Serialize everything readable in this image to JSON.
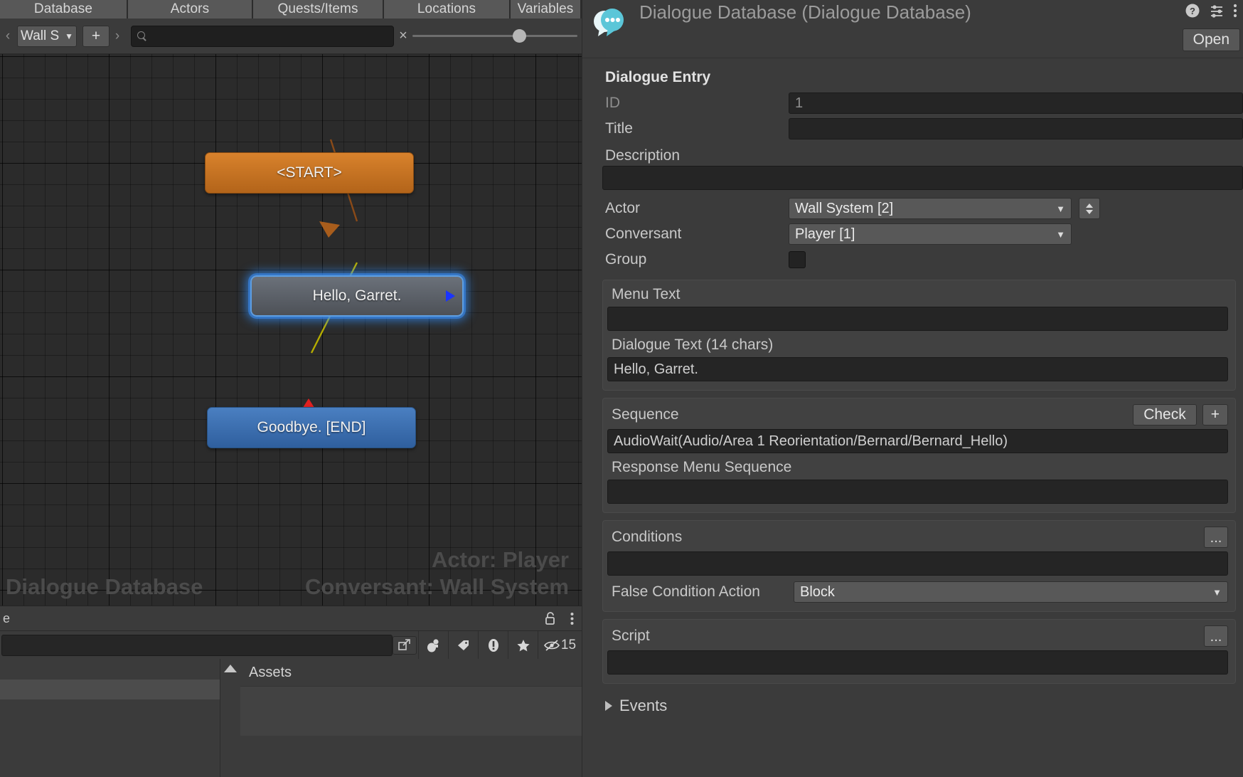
{
  "editor": {
    "tabs": [
      {
        "label": "Database",
        "name": "tab-database"
      },
      {
        "label": "Actors",
        "name": "tab-actors"
      },
      {
        "label": "Quests/Items",
        "name": "tab-quests-items"
      },
      {
        "label": "Locations",
        "name": "tab-locations"
      },
      {
        "label": "Variables",
        "name": "tab-variables"
      }
    ],
    "toolbar": {
      "prev_arrow": "‹",
      "next_arrow": "›",
      "conversation_picker": "Wall S",
      "picker_caret": "▼",
      "add_label": "+",
      "search_value": "",
      "search_placeholder": "",
      "clear_label": "×"
    },
    "graph": {
      "nodes": [
        {
          "label": "<START>",
          "name": "node-start"
        },
        {
          "label": "Hello, Garret.",
          "name": "node-hello-garret"
        },
        {
          "label": "Goodbye. [END]",
          "name": "node-goodbye-end"
        }
      ],
      "watermarks": {
        "database": "Dialogue Database",
        "actor": "Actor: Player",
        "conversant": "Conversant: Wall System"
      },
      "link_colors": {
        "start_link": "#8a4a18",
        "selected_link": "#b5ad00",
        "port_blue": "#1a34ff",
        "incoming_red": "#e02020"
      }
    },
    "left_strip": {
      "fragment_text": "e",
      "lock_icon": "lock-open-icon",
      "menu_icon": "kebab-menu-icon"
    },
    "status_bar": {
      "message": "",
      "popout_icon": "popout-icon",
      "icons": [
        {
          "name": "account-icon",
          "glyph": ""
        },
        {
          "name": "tag-icon",
          "glyph": ""
        },
        {
          "name": "warning-icon",
          "glyph": ""
        },
        {
          "name": "favorite-star-icon",
          "glyph": ""
        }
      ],
      "hidden_count": "15",
      "hidden_icon": "eye-off-icon"
    },
    "project": {
      "assets_label": "Assets",
      "collapse_icon": "triangle-up-icon"
    }
  },
  "inspector": {
    "icon_name": "dialogue-database-icon",
    "title": "Dialogue Database (Dialogue Database)",
    "help_icon": "help-icon",
    "preset_icon": "preset-sliders-icon",
    "menu_icon": "kebab-menu-icon",
    "open_label": "Open",
    "section_title": "Dialogue Entry",
    "fields": {
      "id_label": "ID",
      "id_value": "1",
      "title_label": "Title",
      "title_value": "",
      "description_label": "Description",
      "description_value": "",
      "actor_label": "Actor",
      "actor_value": "Wall System [2]",
      "conversant_label": "Conversant",
      "conversant_value": "Player [1]",
      "group_label": "Group",
      "group_checked": false
    },
    "text_group": {
      "menu_text_label": "Menu Text",
      "menu_text_value": "",
      "dialogue_text_label": "Dialogue Text (14 chars)",
      "dialogue_text_value": "Hello, Garret."
    },
    "sequence_group": {
      "sequence_label": "Sequence",
      "check_label": "Check",
      "add_label": "+",
      "sequence_value": "AudioWait(Audio/Area 1 Reorientation/Bernard/Bernard_Hello)",
      "response_menu_label": "Response Menu Sequence",
      "response_menu_value": ""
    },
    "conditions_group": {
      "conditions_label": "Conditions",
      "dots_label": "...",
      "conditions_value": "",
      "false_action_label": "False Condition Action",
      "false_action_value": "Block"
    },
    "script_group": {
      "script_label": "Script",
      "dots_label": "...",
      "script_value": ""
    },
    "events": {
      "label": "Events",
      "expanded": false
    },
    "caret_glyph": "▼"
  },
  "colors": {
    "accent_orange": "#c9731f",
    "accent_blue": "#3a6dac",
    "selection_glow": "#3c8cf0",
    "panel_bg": "#3b3b3b",
    "canvas_bg": "#2b2b2b"
  }
}
